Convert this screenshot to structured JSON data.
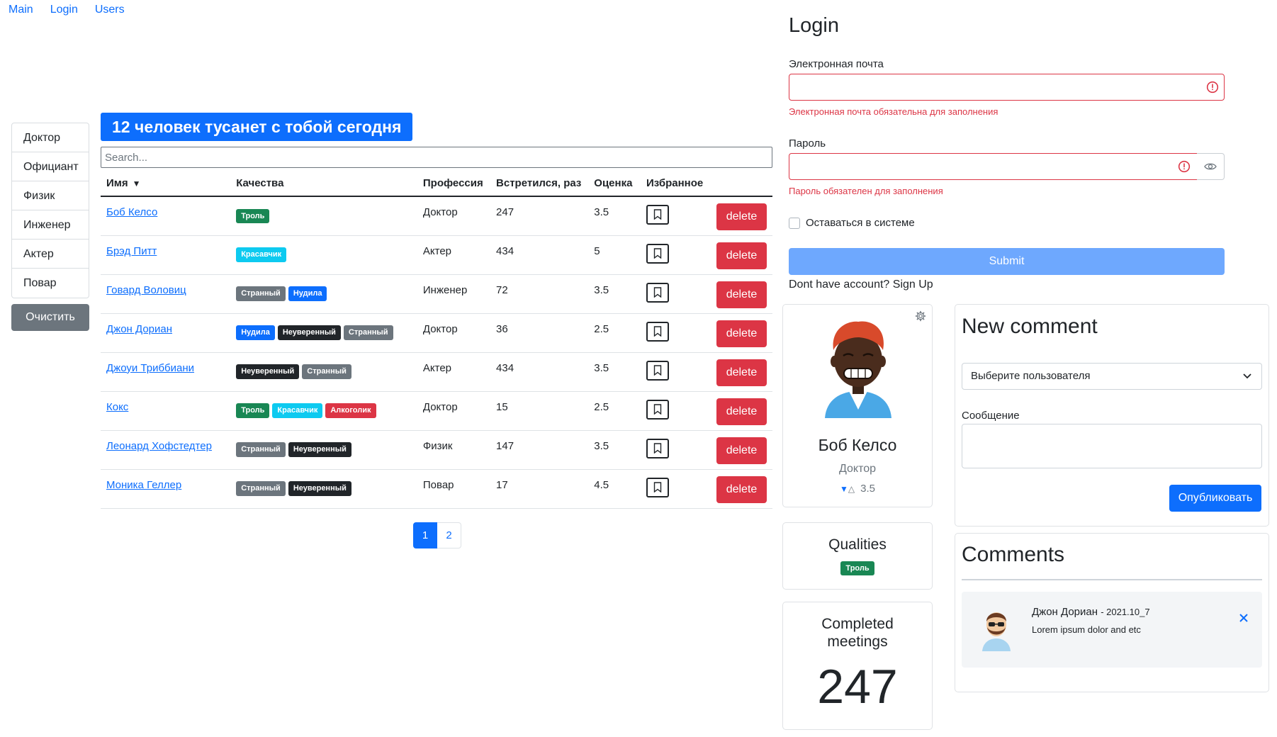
{
  "nav": {
    "items": [
      "Main",
      "Login",
      "Users"
    ]
  },
  "professions": {
    "items": [
      "Доктор",
      "Официант",
      "Физик",
      "Инженер",
      "Актер",
      "Повар"
    ],
    "clear_label": "Очистить"
  },
  "title": "12 человек тусанет с тобой сегодня",
  "search": {
    "placeholder": "Search..."
  },
  "table": {
    "columns": [
      "Имя",
      "Качества",
      "Профессия",
      "Встретился, раз",
      "Оценка",
      "Избранное"
    ],
    "delete_label": "delete",
    "rows": [
      {
        "name": "Боб Келсо",
        "qualities": [
          {
            "label": "Троль",
            "color": "#198754"
          }
        ],
        "profession": "Доктор",
        "meetings": "247",
        "rate": "3.5"
      },
      {
        "name": "Брэд Питт",
        "qualities": [
          {
            "label": "Красавчик",
            "color": "#0dcaf0"
          }
        ],
        "profession": "Актер",
        "meetings": "434",
        "rate": "5"
      },
      {
        "name": "Говард Воловиц",
        "qualities": [
          {
            "label": "Странный",
            "color": "#6c757d"
          },
          {
            "label": "Нудила",
            "color": "#0d6efd"
          }
        ],
        "profession": "Инженер",
        "meetings": "72",
        "rate": "3.5"
      },
      {
        "name": "Джон Дориан",
        "qualities": [
          {
            "label": "Нудила",
            "color": "#0d6efd"
          },
          {
            "label": "Неуверенный",
            "color": "#212529"
          },
          {
            "label": "Странный",
            "color": "#6c757d"
          }
        ],
        "profession": "Доктор",
        "meetings": "36",
        "rate": "2.5"
      },
      {
        "name": "Джоуи Триббиани",
        "qualities": [
          {
            "label": "Неуверенный",
            "color": "#212529"
          },
          {
            "label": "Странный",
            "color": "#6c757d"
          }
        ],
        "profession": "Актер",
        "meetings": "434",
        "rate": "3.5"
      },
      {
        "name": "Кокс",
        "qualities": [
          {
            "label": "Троль",
            "color": "#198754"
          },
          {
            "label": "Красавчик",
            "color": "#0dcaf0"
          },
          {
            "label": "Алкоголик",
            "color": "#dc3545"
          }
        ],
        "profession": "Доктор",
        "meetings": "15",
        "rate": "2.5"
      },
      {
        "name": "Леонард Хофстедтер",
        "qualities": [
          {
            "label": "Странный",
            "color": "#6c757d"
          },
          {
            "label": "Неуверенный",
            "color": "#212529"
          }
        ],
        "profession": "Физик",
        "meetings": "147",
        "rate": "3.5"
      },
      {
        "name": "Моника Геллер",
        "qualities": [
          {
            "label": "Странный",
            "color": "#6c757d"
          },
          {
            "label": "Неуверенный",
            "color": "#212529"
          }
        ],
        "profession": "Повар",
        "meetings": "17",
        "rate": "4.5"
      }
    ]
  },
  "pagination": {
    "pages": [
      "1",
      "2"
    ],
    "active": "1"
  },
  "login": {
    "title": "Login",
    "email_label": "Электронная почта",
    "email_error": "Электронная почта обязательна для заполнения",
    "password_label": "Пароль",
    "password_error": "Пароль обязателен для заполнения",
    "remember_label": "Оставаться в системе",
    "submit_label": "Submit",
    "signup_text": "Dont have account?",
    "signup_link": "Sign Up"
  },
  "user_card": {
    "name": "Боб Келсо",
    "profession": "Доктор",
    "rate": "3.5"
  },
  "qualities_card": {
    "title": "Qualities",
    "badge": "Троль",
    "badge_color": "#198754"
  },
  "meetings_card": {
    "title_line1": "Completed",
    "title_line2": "meetings",
    "value": "247"
  },
  "new_comment": {
    "title": "New comment",
    "select_value": "Выберите пользователя",
    "message_label": "Сообщение",
    "publish_label": "Опубликовать"
  },
  "comments": {
    "title": "Comments",
    "items": [
      {
        "author": "Джон Дориан",
        "date": "2021.10_7",
        "text": "Lorem ipsum dolor and etc"
      }
    ]
  },
  "colors": {
    "primary": "#0d6efd",
    "danger": "#dc3545",
    "secondary": "#6c757d",
    "success": "#198754"
  }
}
